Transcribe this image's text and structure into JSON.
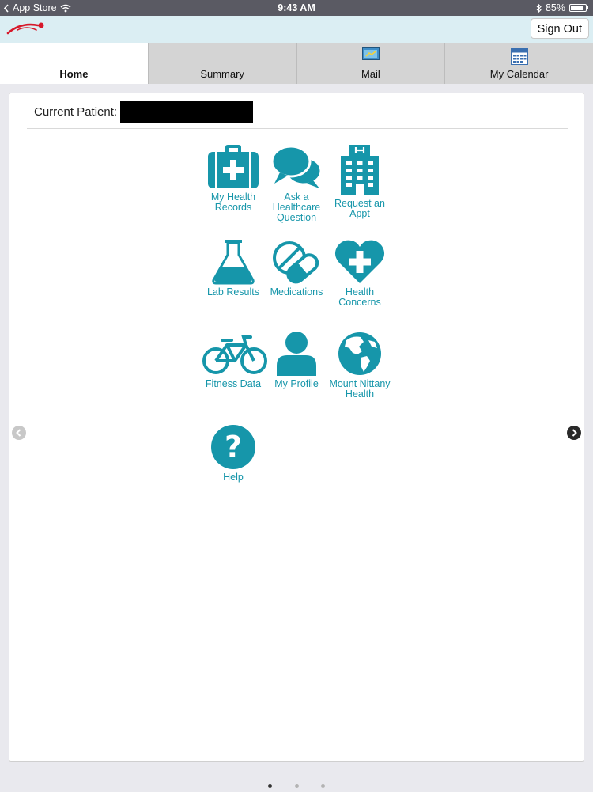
{
  "status_bar": {
    "back_app": "App Store",
    "time": "9:43 AM",
    "battery": "85%",
    "battery_level": 0.85
  },
  "header": {
    "sign_out_label": "Sign Out"
  },
  "tabs": [
    {
      "label": "Home",
      "active": true
    },
    {
      "label": "Summary",
      "active": false
    },
    {
      "label": "Mail",
      "active": false
    },
    {
      "label": "My Calendar",
      "active": false
    }
  ],
  "patient": {
    "label": "Current Patient:",
    "name": ""
  },
  "tiles": [
    {
      "label": "My Health Records",
      "icon": "medical-bag-icon"
    },
    {
      "label": "Ask a Healthcare Question",
      "icon": "chat-bubbles-icon"
    },
    {
      "label": "Request an Appt",
      "icon": "hospital-icon"
    },
    {
      "label": "Lab Results",
      "icon": "flask-icon"
    },
    {
      "label": "Medications",
      "icon": "pills-icon"
    },
    {
      "label": "Health Concerns",
      "icon": "heart-plus-icon"
    },
    {
      "label": "Fitness Data",
      "icon": "bicycle-icon"
    },
    {
      "label": "My Profile",
      "icon": "person-icon"
    },
    {
      "label": "Mount Nittany Health",
      "icon": "globe-icon"
    },
    {
      "label": "Help",
      "icon": "question-icon"
    }
  ],
  "colors": {
    "accent": "#1696aa",
    "status_bar": "#5a5a63",
    "app_bar": "#dbeef3",
    "logo": "#d7182a"
  },
  "pagination": {
    "current": 1,
    "total": 3
  }
}
